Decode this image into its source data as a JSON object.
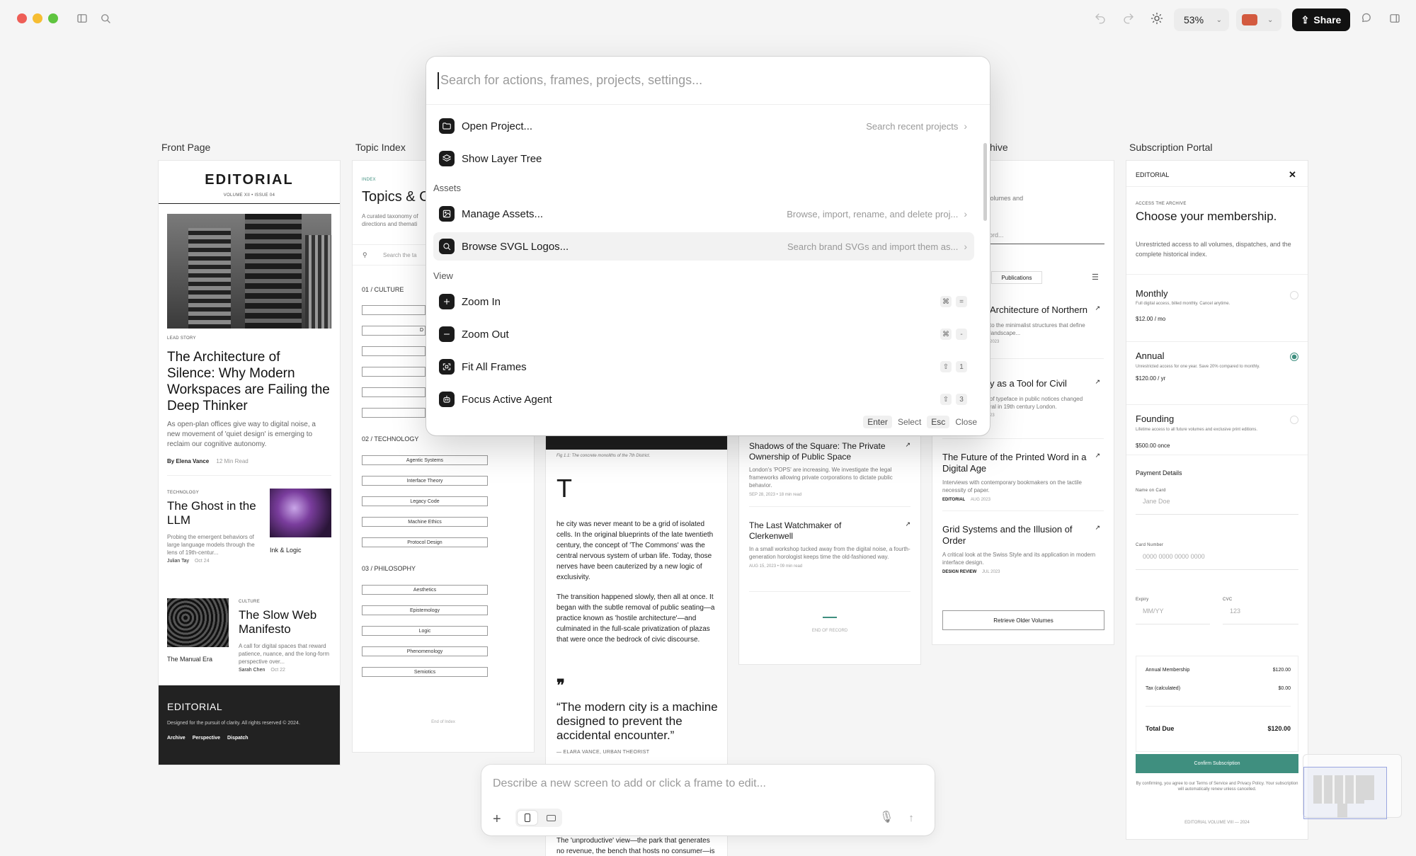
{
  "toolbar": {
    "zoom": "53%",
    "share_label": "Share"
  },
  "colors": {
    "accent_teal": "#3f8f7f",
    "dark": "#111111",
    "window_red": "#ee5e57",
    "window_yellow": "#f6bd32",
    "window_green": "#5fc43f"
  },
  "frames": {
    "front_page": {
      "label": "Front Page",
      "masthead": "EDITORIAL",
      "issue": "VOLUME XII • ISSUE 04",
      "lead_kicker": "LEAD STORY",
      "lead_title": "The Architecture of Silence: Why Modern Workspaces are Failing the Deep Thinker",
      "lead_dek": "As open-plan offices give way to digital noise, a new movement of 'quiet design' is emerging to reclaim our cognitive autonomy.",
      "lead_author": "By Elena Vance",
      "lead_read": "12 Min Read",
      "story2_kicker": "TECHNOLOGY",
      "story2_title": "The Ghost in the LLM",
      "story2_dek": "Probing the emergent behaviors of large language models through the lens of 19th-centur...",
      "story2_author": "Julian Tay",
      "story2_date": "Oct 24",
      "story2_side": "Ink & Logic",
      "story3_kicker": "CULTURE",
      "story3_title": "The Slow Web Manifesto",
      "story3_dek": "A call for digital spaces that reward patience, nuance, and the long-form perspective over...",
      "story3_author": "Sarah Chen",
      "story3_date": "Oct 22",
      "story3_side": "The Manual Era",
      "footer_title": "EDITORIAL",
      "footer_text": "Designed for the pursuit of clarity. All rights reserved © 2024.",
      "footer_links": [
        "Archive",
        "Perspective",
        "Dispatch"
      ]
    },
    "topic_index": {
      "label": "Topic Index",
      "kicker": "INDEX",
      "title": "Topics & C",
      "dek1": "A curated taxonomy of",
      "dek2": "directions and themati",
      "search": "Search the ta",
      "culture": "01 / CULTURE",
      "culture_d": "D",
      "technology": "02 / TECHNOLOGY",
      "technology_items": [
        "Agentic Systems",
        "Interface Theory",
        "Legacy Code",
        "Machine Ethics",
        "Protocol Design"
      ],
      "philosophy": "03 / PHILOSOPHY",
      "philosophy_items": [
        "Aesthetics",
        "Epistemology",
        "Logic",
        "Phenomenology",
        "Semiotics"
      ],
      "end": "End of Index"
    },
    "article": {
      "caption": "Fig 1.1: The concrete monoliths of the 7th District.",
      "dropcap": "T",
      "p1": "he city was never meant to be a grid of isolated cells. In the original blueprints of the late twentieth century, the concept of 'The Commons' was the central nervous system of urban life. Today, those nerves have been cauterized by a new logic of exclusivity.",
      "p2": "The transition happened slowly, then all at once. It began with the subtle removal of public seating—a practice known as 'hostile architecture'—and culminated in the full-scale privatization of plazas that were once the bedrock of civic discourse.",
      "quote": "“The modern city is a machine designed to prevent the accidental encounter.”",
      "quote_author": "— ELARA VANCE, URBAN THEORIST",
      "p3": "The 'unproductive' view—the park that generates no revenue, the bench that hosts no consumer—is"
    },
    "dispatch": {
      "items": [
        {
          "title": "Shadows of the Square: The Private Ownership of Public Space",
          "dek": "London's 'POPS' are increasing. We investigate the legal frameworks allowing private corporations to dictate public behavior.",
          "meta": "SEP 28, 2023  •  18 min read"
        },
        {
          "title": "The Last Watchmaker of Clerkenwell",
          "dek": "In a small workshop tucked away from the digital noise, a fourth-generation horologist keeps time the old-fashioned way.",
          "meta": "AUG 15, 2023  •  09 min read"
        }
      ],
      "end": "END OF RECORD"
    },
    "archive": {
      "label": "hive",
      "dek": "nplete collection of volumes and",
      "search": "title, author, or keyword...",
      "filter": "Publications",
      "items": [
        {
          "title": "Architecture of Northern",
          "dek": "to the minimalist structures that define landscape...",
          "meta": "2023"
        },
        {
          "title": "y as a Tool for Civil",
          "dek": "of typeface in public notices changed ral in 19th century London.",
          "meta": "23"
        },
        {
          "title": "The Future of the Printed Word in a Digital Age",
          "dek": "Interviews with contemporary bookmakers on the tactile necessity of paper.",
          "tag": "EDITORIAL",
          "meta": "AUG 2023"
        },
        {
          "title": "Grid Systems and the Illusion of Order",
          "dek": "A critical look at the Swiss Style and its application in modern interface design.",
          "tag": "DESIGN REVIEW",
          "meta": "JUL 2023"
        }
      ],
      "button": "Retrieve Older Volumes"
    },
    "subscription": {
      "label": "Subscription Portal",
      "brand": "EDITORIAL",
      "kicker": "ACCESS THE ARCHIVE",
      "title": "Choose your membership.",
      "dek": "Unrestricted access to all volumes, dispatches, and the complete historical index.",
      "plans": [
        {
          "name": "Monthly",
          "desc": "Full digital access, billed monthly. Cancel anytime.",
          "price": "$12.00 / mo"
        },
        {
          "name": "Annual",
          "desc": "Unrestricted access for one year. Save 20% compared to monthly.",
          "price": "$120.00 / yr"
        },
        {
          "name": "Founding",
          "desc": "Lifetime access to all future volumes and exclusive print editions.",
          "price": "$500.00 once"
        }
      ],
      "payment_title": "Payment Details",
      "name_label": "Name on Card",
      "name_ph": "Jane Doe",
      "card_label": "Card Number",
      "card_ph": "0000 0000 0000 0000",
      "expiry_label": "Expiry",
      "expiry_ph": "MM/YY",
      "cvc_label": "CVC",
      "cvc_ph": "123",
      "summary": [
        {
          "label": "Annual Membership",
          "value": "$120.00"
        },
        {
          "label": "Tax (calculated)",
          "value": "$0.00"
        }
      ],
      "total_label": "Total Due",
      "total_value": "$120.00",
      "confirm": "Confirm Subscription",
      "terms": "By confirming, you agree to our Terms of Service and Privacy Policy. Your subscription will automatically renew unless cancelled.",
      "footer": "EDITORIAL VOLUME VIII — 2024"
    }
  },
  "palette": {
    "placeholder": "Search for actions, frames, projects, settings...",
    "items_top": [
      {
        "label": "Open Project...",
        "hint": "Search recent projects",
        "icon": "folder-icon"
      },
      {
        "label": "Show Layer Tree",
        "hint": "",
        "icon": "layers-icon"
      }
    ],
    "section_assets": "Assets",
    "assets": [
      {
        "label": "Manage Assets...",
        "hint": "Browse, import, rename, and delete proj...",
        "icon": "image-icon"
      },
      {
        "label": "Browse SVGL Logos...",
        "hint": "Search brand SVGs and import them as...",
        "icon": "search-icon"
      }
    ],
    "section_view": "View",
    "view": [
      {
        "label": "Zoom In",
        "k1": "⌘",
        "k2": "="
      },
      {
        "label": "Zoom Out",
        "k1": "⌘",
        "k2": "-"
      },
      {
        "label": "Fit All Frames",
        "k1": "⇧",
        "k2": "1"
      },
      {
        "label": "Focus Active Agent",
        "k1": "⇧",
        "k2": "3"
      }
    ],
    "footer": {
      "enter": "Enter",
      "select": "Select",
      "esc": "Esc",
      "close": "Close"
    }
  },
  "prompt": {
    "placeholder": "Describe a new screen to add or click a frame to edit..."
  }
}
